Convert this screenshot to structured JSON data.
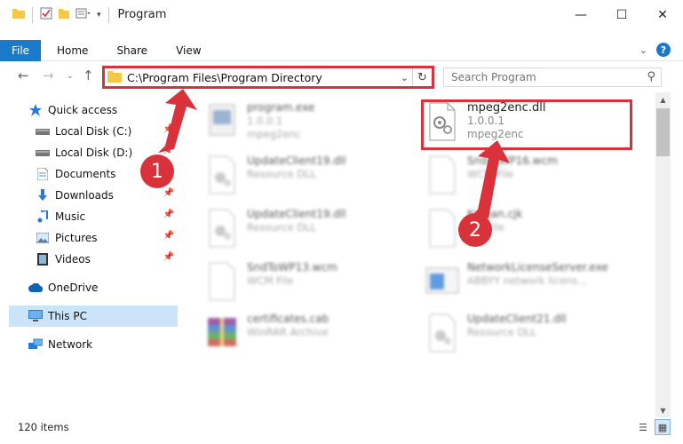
{
  "window": {
    "title": "Program"
  },
  "ribbon": {
    "file": "File",
    "tabs": [
      "Home",
      "Share",
      "View"
    ]
  },
  "address": {
    "path": "C:\\Program Files\\Program Directory"
  },
  "search": {
    "placeholder": "Search Program"
  },
  "sidebar": {
    "items": [
      {
        "label": "Quick access",
        "icon": "star-icon",
        "pinned": false
      },
      {
        "label": "Local Disk (C:)",
        "icon": "drive-icon",
        "pinned": true
      },
      {
        "label": "Local Disk (D:)",
        "icon": "drive-icon",
        "pinned": true
      },
      {
        "label": "Documents",
        "icon": "documents-icon",
        "pinned": true
      },
      {
        "label": "Downloads",
        "icon": "downloads-icon",
        "pinned": true
      },
      {
        "label": "Music",
        "icon": "music-icon",
        "pinned": true
      },
      {
        "label": "Pictures",
        "icon": "pictures-icon",
        "pinned": true
      },
      {
        "label": "Videos",
        "icon": "videos-icon",
        "pinned": true
      },
      {
        "label": "OneDrive",
        "icon": "cloud-icon",
        "pinned": false
      },
      {
        "label": "This PC",
        "icon": "computer-icon",
        "pinned": false,
        "selected": true
      },
      {
        "label": "Network",
        "icon": "network-icon",
        "pinned": false
      }
    ]
  },
  "files": [
    {
      "name": "program.exe",
      "line2": "1.0.0.1",
      "line3": "mpeg2enc",
      "icon": "exe-icon"
    },
    {
      "name": "mpeg2enc.dll",
      "line2": "1.0.0.1",
      "line3": "mpeg2enc",
      "icon": "dll-icon"
    },
    {
      "name": "UpdateClient19.dll",
      "line2": "Resource DLL",
      "icon": "dll-icon"
    },
    {
      "name": "SndToWP16.wcm",
      "line2": "WCM File",
      "icon": "file-icon"
    },
    {
      "name": "UpdateClient19.dll",
      "line2": "Resource DLL",
      "icon": "dll-icon"
    },
    {
      "name": "Korean.cjk",
      "line2": "CJK File",
      "icon": "file-icon"
    },
    {
      "name": "SndToWP13.wcm",
      "line2": "WCM File",
      "icon": "file-icon"
    },
    {
      "name": "NetworkLicenseServer.exe",
      "line2": "ABBYY network licens...",
      "icon": "app-icon"
    },
    {
      "name": "certificates.cab",
      "line2": "WinRAR Archive",
      "icon": "archive-icon"
    },
    {
      "name": "UpdateClient21.dll",
      "line2": "Resource DLL",
      "icon": "dll-icon"
    }
  ],
  "status": {
    "item_count": "120 items"
  },
  "annotations": {
    "step1": "1",
    "step2": "2",
    "color": "#d9323a"
  }
}
